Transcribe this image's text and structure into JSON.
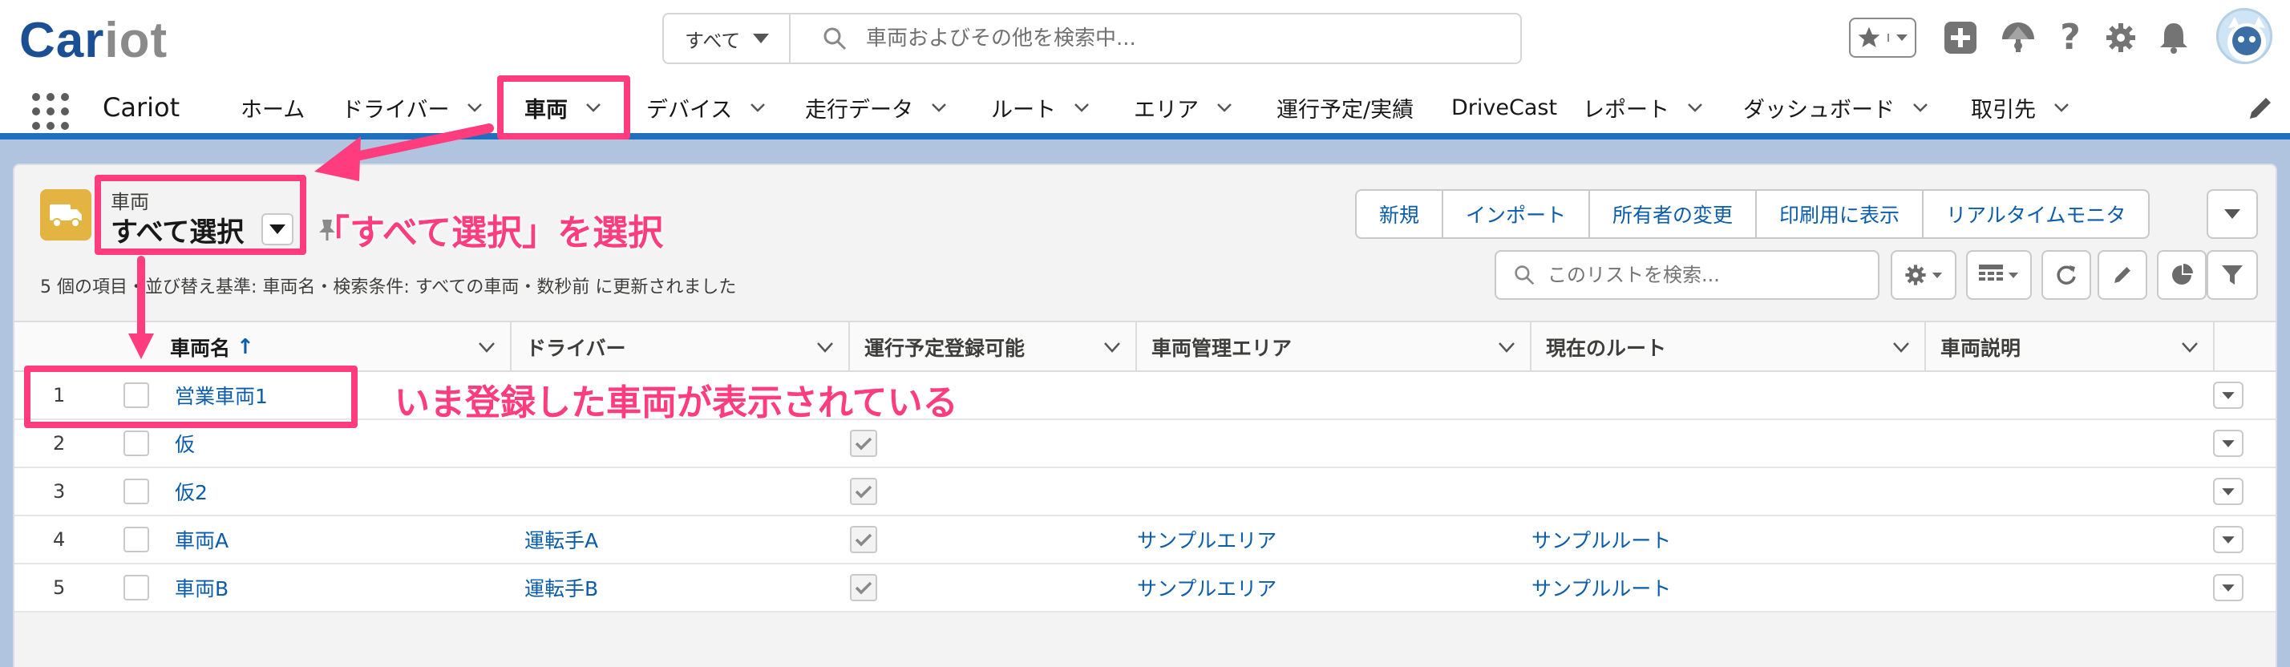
{
  "colors": {
    "brand": "#1b4f94",
    "link": "#0b5cab",
    "nav_bar": "#1f6fbf",
    "object_icon": "#e3b441",
    "annotation": "#ff3c7d"
  },
  "header": {
    "logo": {
      "main": "Car",
      "accent": "iot"
    },
    "search": {
      "scope": "すべて",
      "placeholder": "車両およびその他を検索中..."
    },
    "icons": [
      "star-icon",
      "chevron-down-icon",
      "plus-icon",
      "trailhead-icon",
      "question-icon",
      "gear-icon",
      "bell-icon",
      "avatar"
    ]
  },
  "nav": {
    "app_name": "Cariot",
    "items": [
      {
        "label": "ホーム",
        "has_menu": false
      },
      {
        "label": "ドライバー",
        "has_menu": true
      },
      {
        "label": "車両",
        "has_menu": true,
        "active": true
      },
      {
        "label": "デバイス",
        "has_menu": true
      },
      {
        "label": "走行データ",
        "has_menu": true
      },
      {
        "label": "ルート",
        "has_menu": true
      },
      {
        "label": "エリア",
        "has_menu": true
      },
      {
        "label": "運行予定/実績",
        "has_menu": false
      },
      {
        "label": "DriveCast",
        "has_menu": false
      },
      {
        "label": "レポート",
        "has_menu": true
      },
      {
        "label": "ダッシュボード",
        "has_menu": true
      },
      {
        "label": "取引先",
        "has_menu": true
      }
    ]
  },
  "list_view": {
    "object_label": "車両",
    "name": "すべて選択",
    "status": "5 個の項目・並び替え基準: 車両名・検索条件: すべての車両・数秒前 に更新されました",
    "actions": [
      "新規",
      "インポート",
      "所有者の変更",
      "印刷用に表示",
      "リアルタイムモニタ"
    ],
    "search_placeholder": "このリストを検索...",
    "toolbar_icons": [
      "gear-icon",
      "table-icon",
      "refresh-icon",
      "pencil-icon",
      "chart-icon",
      "filter-icon"
    ]
  },
  "table": {
    "columns": [
      "車両名",
      "ドライバー",
      "運行予定登録可能",
      "車両管理エリア",
      "現在のルート",
      "車両説明"
    ],
    "sort_indicator": "↑",
    "rows": [
      {
        "num": "1",
        "name": "営業車両1",
        "driver": "",
        "schedulable": false,
        "area": "",
        "route": "",
        "desc": ""
      },
      {
        "num": "2",
        "name": "仮",
        "driver": "",
        "schedulable": true,
        "area": "",
        "route": "",
        "desc": ""
      },
      {
        "num": "3",
        "name": "仮2",
        "driver": "",
        "schedulable": true,
        "area": "",
        "route": "",
        "desc": ""
      },
      {
        "num": "4",
        "name": "車両A",
        "driver": "運転手A",
        "schedulable": true,
        "area": "サンプルエリア",
        "route": "サンプルルート",
        "desc": ""
      },
      {
        "num": "5",
        "name": "車両B",
        "driver": "運転手B",
        "schedulable": true,
        "area": "サンプルエリア",
        "route": "サンプルルート",
        "desc": ""
      }
    ]
  },
  "annotations": {
    "select_all": "「すべて選択」を選択",
    "new_vehicle": "いま登録した車両が表示されている"
  }
}
